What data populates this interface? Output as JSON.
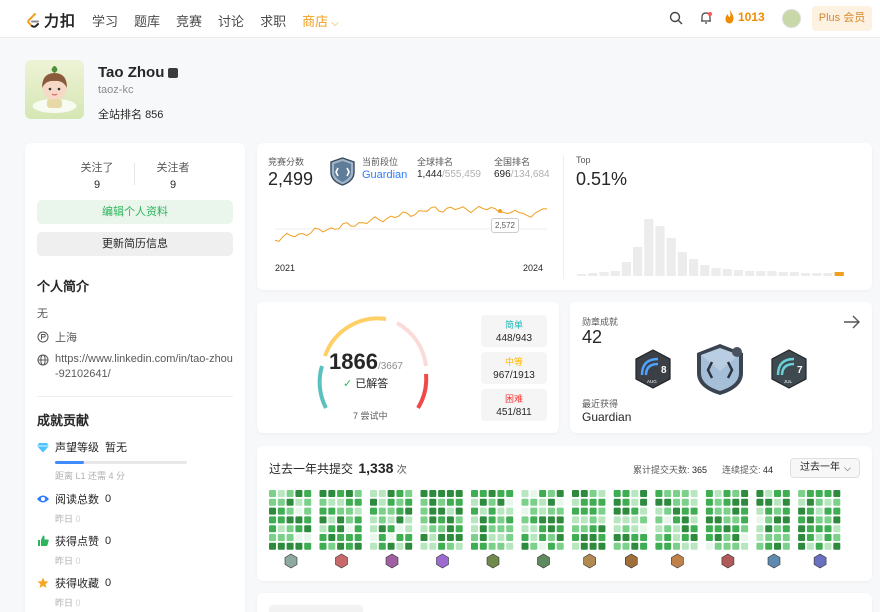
{
  "topbar": {
    "logo_text": "力扣",
    "nav": [
      "学习",
      "题库",
      "竞赛",
      "讨论",
      "求职"
    ],
    "store": "商店",
    "streak": "1013",
    "plus": "Plus 会员"
  },
  "profile": {
    "name": "Tao Zhou",
    "handle": "taoz-kc",
    "rank_label": "全站排名",
    "rank_value": "856"
  },
  "left": {
    "following_label": "关注了",
    "following": "9",
    "followers_label": "关注者",
    "followers": "9",
    "edit_btn": "编辑个人资料",
    "resume_btn": "更新简历信息",
    "bio_title": "个人简介",
    "bio": "无",
    "location": "上海",
    "link_line1": "https://www.linkedin.com/in/tao-zhou",
    "link_line2": "-92102641/",
    "contrib_title": "成就贡献",
    "reputation_label": "声望等级",
    "reputation_value": "暂无",
    "reputation_progress": 0.22,
    "reputation_note": "距离 L1 还需 4 分",
    "reads_label": "阅读总数",
    "reads_value": "0",
    "likes_label": "获得点赞",
    "likes_value": "0",
    "fav_label": "获得收藏",
    "fav_value": "0",
    "yesterday": "昨日",
    "yesterday_value": "0"
  },
  "contest": {
    "score_label": "竞赛分数",
    "score": "2,499",
    "level_label": "当前段位",
    "level": "Guardian",
    "global_label": "全球排名",
    "global_rank": "1,444",
    "global_total": "/555,459",
    "national_label": "全国排名",
    "national_rank": "696",
    "national_total": "/134,684",
    "year_start": "2021",
    "year_end": "2024",
    "tooltip": "2,572",
    "top_label": "Top",
    "top_value": "0.51%",
    "accent": "#f0a020"
  },
  "solved": {
    "count": "1866",
    "total": "/3667",
    "solved_label": "已解答",
    "attempting": "7 尝试中",
    "easy_label": "简单",
    "easy": "448/943",
    "medium_label": "中等",
    "medium": "967/1913",
    "hard_label": "困难",
    "hard": "451/811",
    "colors": {
      "easy": "#1cb8b8",
      "medium": "#ffb700",
      "hard": "#f63636"
    }
  },
  "badges": {
    "title": "勋章成就",
    "count": "42",
    "recent_label": "最近获得",
    "recent": "Guardian",
    "items": [
      {
        "icon": "aug-badge-icon",
        "num": "8",
        "month": "AUG"
      },
      {
        "icon": "guardian-badge-icon"
      },
      {
        "icon": "jul-badge-icon",
        "num": "7",
        "month": "JUL"
      }
    ]
  },
  "year": {
    "title": "过去一年共提交",
    "count": "1,338",
    "unit": "次",
    "days_label": "累计提交天数:",
    "days": "365",
    "streak_label": "连续提交:",
    "streak": "44",
    "select": "过去一年"
  }
}
